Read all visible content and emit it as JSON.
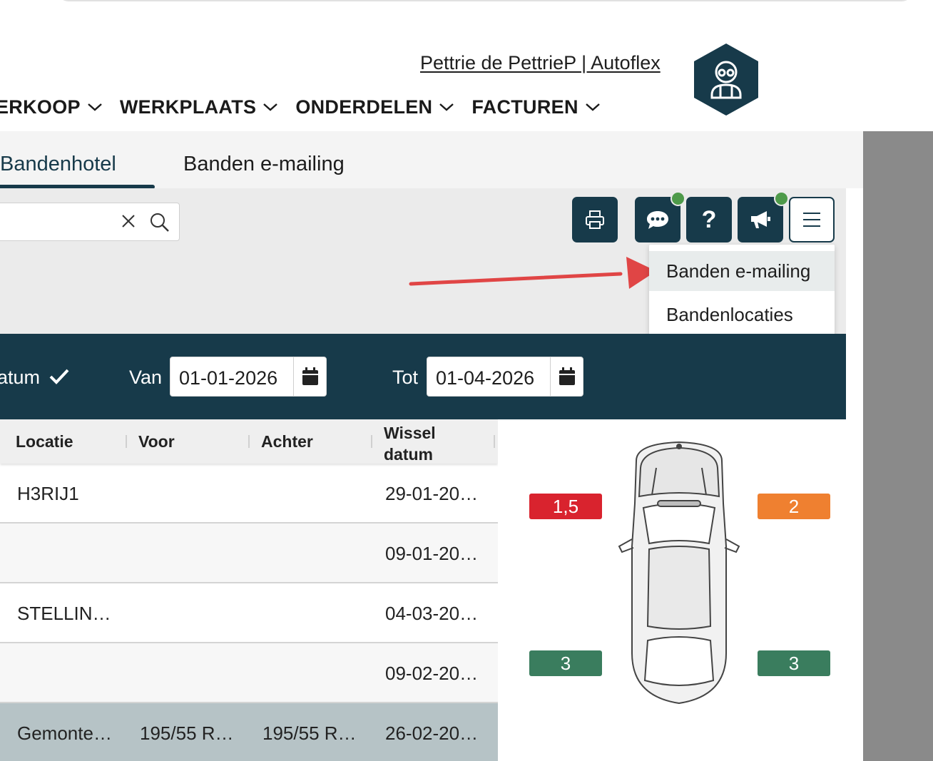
{
  "header": {
    "user_label": "Pettrie de PettrieP | Autoflex"
  },
  "nav": {
    "items": [
      "ERKOOP",
      "WERKPLAATS",
      "ONDERDELEN",
      "FACTUREN"
    ]
  },
  "tabs": {
    "active": "Bandenhotel",
    "inactive": "Banden e-mailing"
  },
  "toolbar": {
    "help_label": "?"
  },
  "dropdown": {
    "items": [
      "Banden e-mailing",
      "Bandenlocaties"
    ]
  },
  "filters": {
    "date_label": "atum",
    "from_label": "Van",
    "from_value": "01-01-2026",
    "to_label": "Tot",
    "to_value": "01-04-2026"
  },
  "table": {
    "headers": [
      "Locatie",
      "Voor",
      "Achter",
      "Wissel datum"
    ],
    "rows": [
      [
        "H3RIJ1",
        "",
        "",
        "29-01-20…"
      ],
      [
        "",
        "",
        "",
        "09-01-20…"
      ],
      [
        "STELLIN…",
        "",
        "",
        "04-03-20…"
      ],
      [
        "",
        "",
        "",
        "09-02-20…"
      ],
      [
        "Gemonte…",
        "195/55 R…",
        "195/55 R…",
        "26-02-20…"
      ]
    ]
  },
  "tire_depths": {
    "front_left": "1,5",
    "front_right": "2",
    "rear_left": "3",
    "rear_right": "3"
  },
  "colors": {
    "primary": "#173a4a",
    "depth_red": "#d9232e",
    "depth_orange": "#ef8030",
    "depth_green": "#3a7d5e",
    "notification_dot": "#4e9a4a",
    "annotation_arrow": "#e04545"
  }
}
